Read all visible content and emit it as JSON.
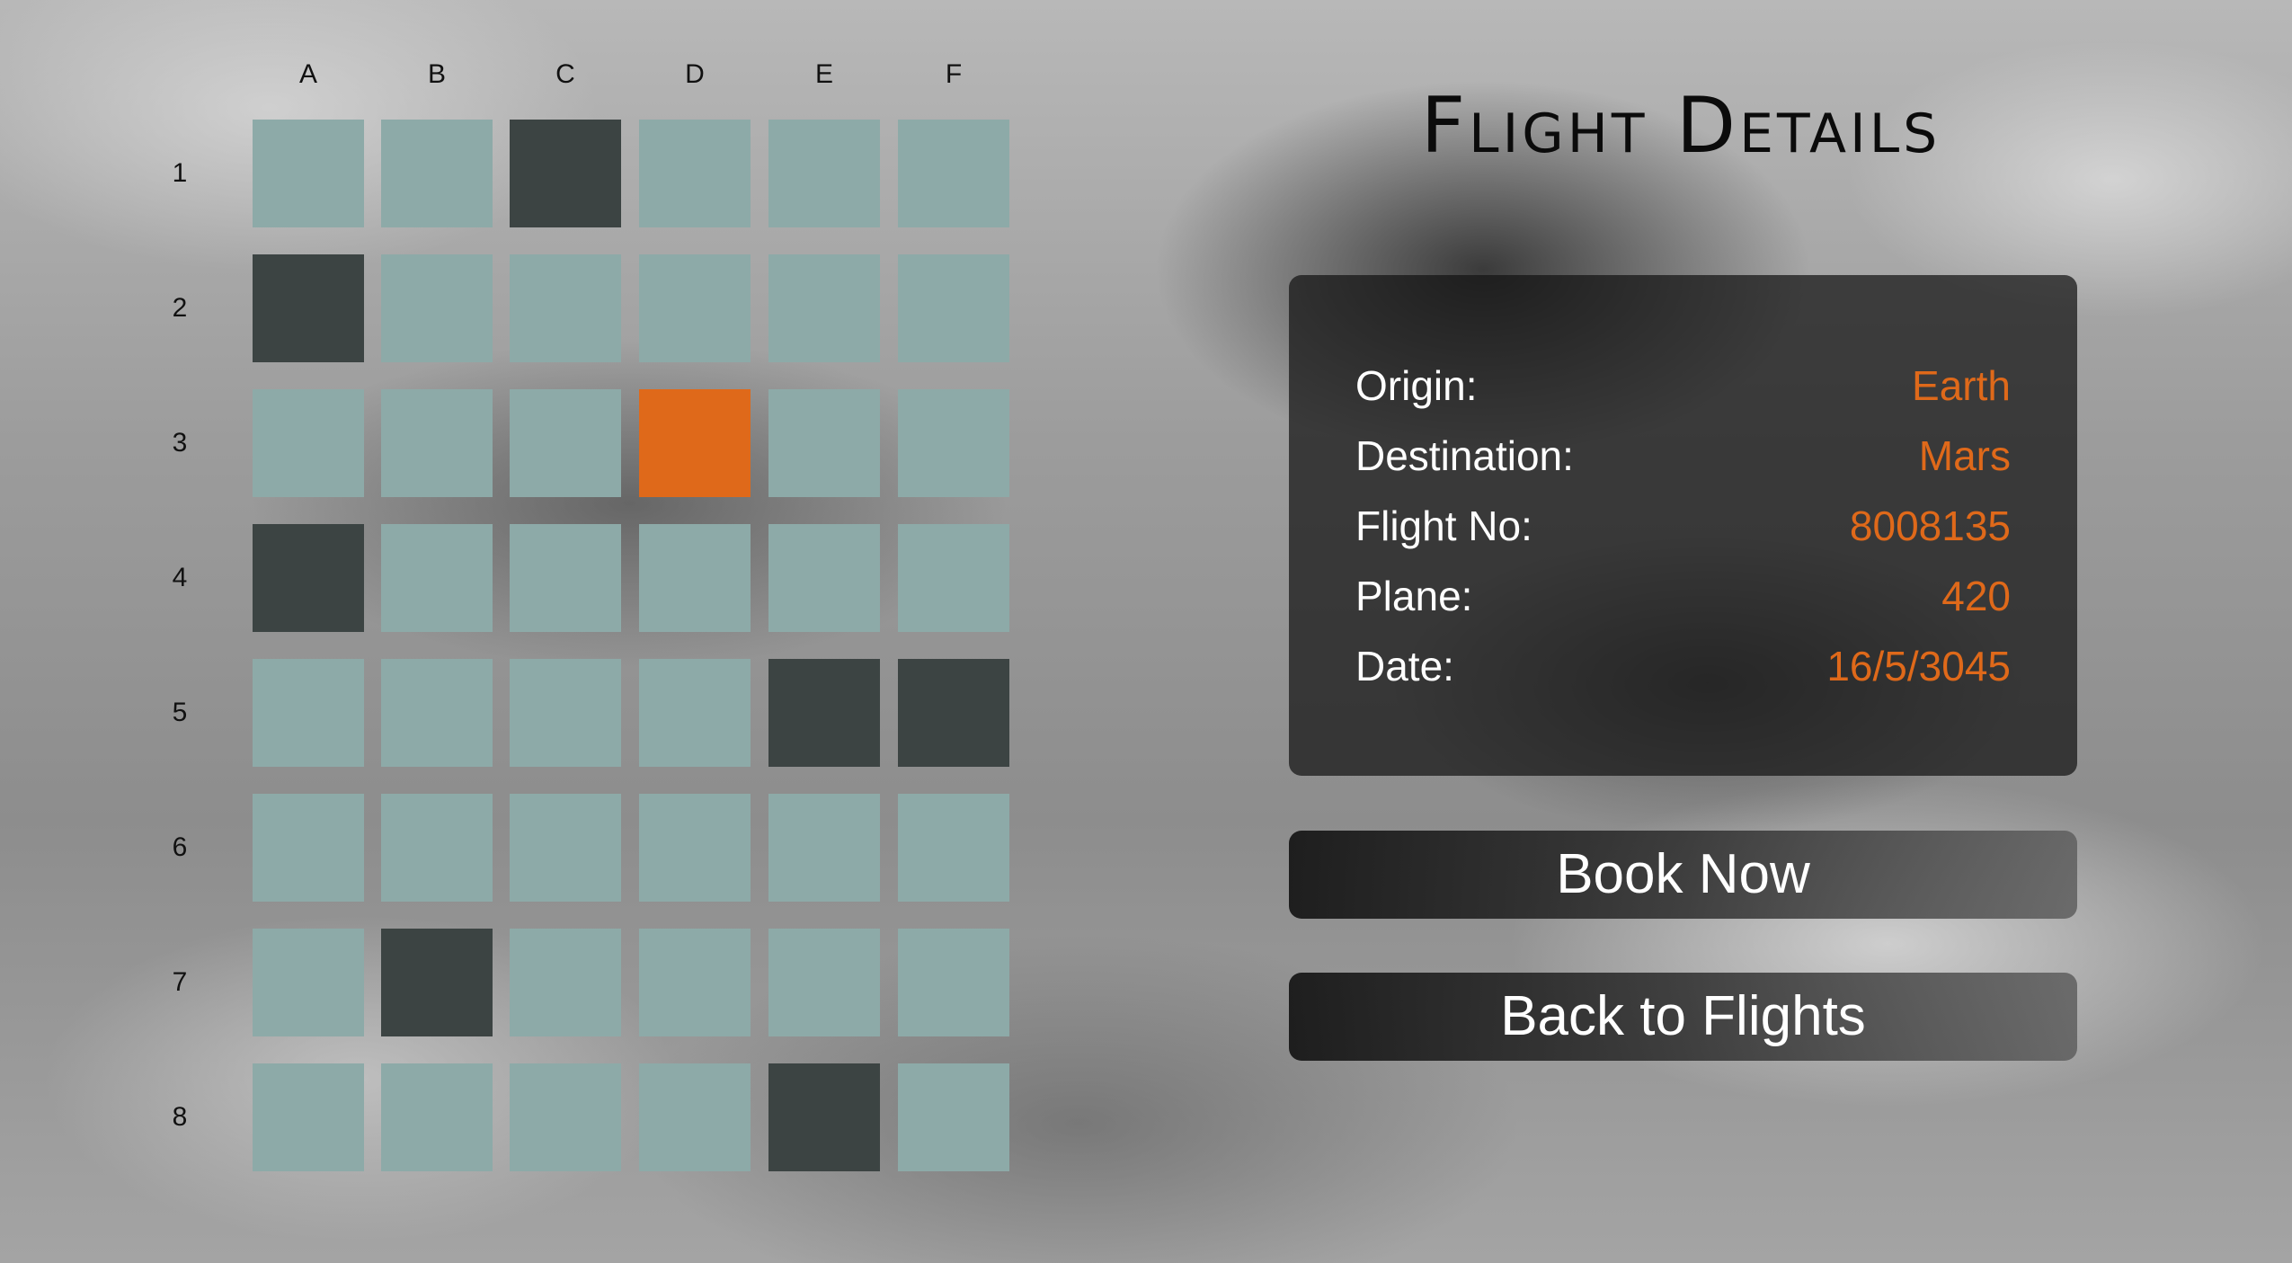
{
  "seat_map": {
    "columns": [
      "A",
      "B",
      "C",
      "D",
      "E",
      "F"
    ],
    "rows": [
      "1",
      "2",
      "3",
      "4",
      "5",
      "6",
      "7",
      "8"
    ],
    "colors": {
      "available": "#8daaa8",
      "taken": "#3c4443",
      "selected": "#df691a"
    },
    "seats": [
      [
        "available",
        "available",
        "taken",
        "available",
        "available",
        "available"
      ],
      [
        "taken",
        "available",
        "available",
        "available",
        "available",
        "available"
      ],
      [
        "available",
        "available",
        "available",
        "selected",
        "available",
        "available"
      ],
      [
        "taken",
        "available",
        "available",
        "available",
        "available",
        "available"
      ],
      [
        "available",
        "available",
        "available",
        "available",
        "taken",
        "taken"
      ],
      [
        "available",
        "available",
        "available",
        "available",
        "available",
        "available"
      ],
      [
        "available",
        "taken",
        "available",
        "available",
        "available",
        "available"
      ],
      [
        "available",
        "available",
        "available",
        "available",
        "taken",
        "available"
      ]
    ]
  },
  "title": "Flight Details",
  "details": [
    {
      "label": "Origin:",
      "value": "Earth"
    },
    {
      "label": "Destination:",
      "value": "Mars"
    },
    {
      "label": "Flight No:",
      "value": "8008135"
    },
    {
      "label": "Plane:",
      "value": "420"
    },
    {
      "label": "Date:",
      "value": "16/5/3045"
    }
  ],
  "accent_color": "#df691a",
  "buttons": {
    "book": "Book Now",
    "back": "Back to Flights"
  }
}
